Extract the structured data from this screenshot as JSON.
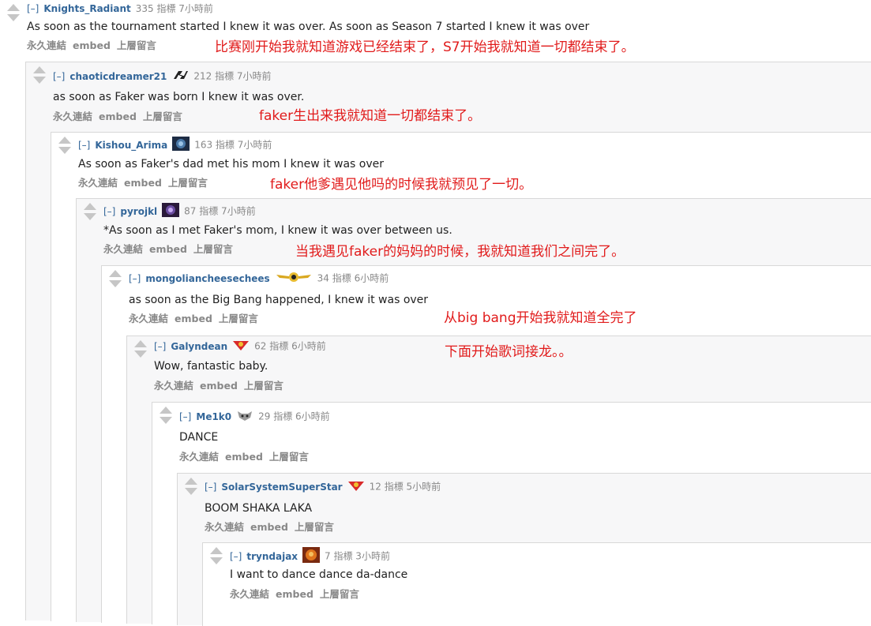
{
  "buttons": {
    "permalink": "永久連結",
    "embed": "embed",
    "parent": "上層留言"
  },
  "comments": [
    {
      "expand": "[–]",
      "author": "Knights_Radiant",
      "meta": "335 指標 7小時前",
      "body": "As soon as the tournament started I knew it was over. As soon as Season 7 started I knew it was over",
      "annotation": "比赛刚开始我就知道游戏已经结束了，S7开始我就知道一切都结束了。"
    },
    {
      "expand": "[–]",
      "author": "chaoticdreamer21",
      "meta": "212 指標 7小時前",
      "body": "as soon as Faker was born I knew it was over.",
      "annotation": "faker生出来我就知道一切都结束了。"
    },
    {
      "expand": "[–]",
      "author": "Kishou_Arima",
      "meta": "163 指標 7小時前",
      "body": "As soon as Faker's dad met his mom I knew it was over",
      "annotation": "faker他爹遇见他吗的时候我就预见了一切。"
    },
    {
      "expand": "[–]",
      "author": "pyrojkl",
      "meta": "87 指標 7小時前",
      "body": "*As soon as I met Faker's mom, I knew it was over between us.",
      "annotation": "当我遇见faker的妈妈的时候，我就知道我们之间完了。"
    },
    {
      "expand": "[–]",
      "author": "mongoliancheesechees",
      "meta": "34 指標 6小時前",
      "body": "as soon as the Big Bang happened, I knew it was over",
      "annotation": "从big bang开始我就知道全完了"
    },
    {
      "expand": "[–]",
      "author": "Galyndean",
      "meta": "62 指標 6小時前",
      "body": "Wow, fantastic baby.",
      "annotation": "下面开始歌词接龙。。"
    },
    {
      "expand": "[–]",
      "author": "Me1k0",
      "meta": "29 指標 6小時前",
      "body": "DANCE",
      "annotation": ""
    },
    {
      "expand": "[–]",
      "author": "SolarSystemSuperStar",
      "meta": "12 指標 5小時前",
      "body": "BOOM SHAKA LAKA",
      "annotation": ""
    },
    {
      "expand": "[–]",
      "author": "tryndajax",
      "meta": "7 指標 3小時前",
      "body": "I want to dance dance da-dance",
      "annotation": ""
    }
  ],
  "colors": {
    "link": "#336699",
    "annotation": "#e11b1b",
    "meta": "#888888",
    "border": "#d8d8d8"
  }
}
